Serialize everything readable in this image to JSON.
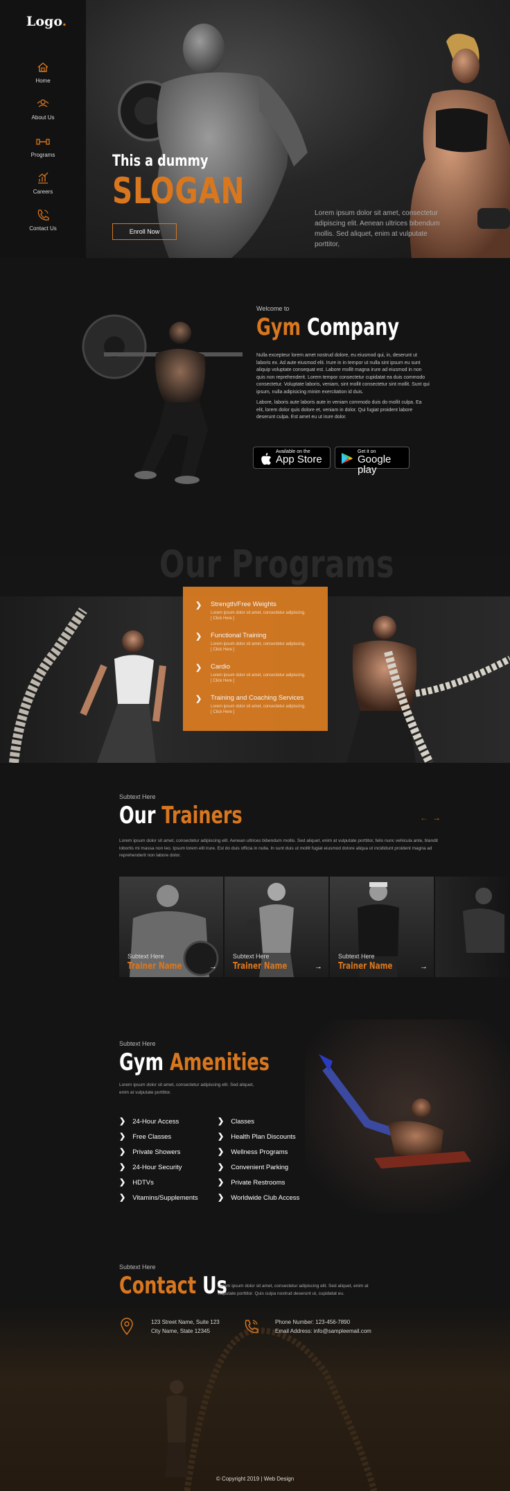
{
  "brand": {
    "logo_text": "Logo",
    "logo_dot": ".",
    "accent": "#d9771f"
  },
  "nav": {
    "items": [
      {
        "label": "Home",
        "icon": "home-icon"
      },
      {
        "label": "About Us",
        "icon": "about-icon"
      },
      {
        "label": "Programs",
        "icon": "dumbbell-icon"
      },
      {
        "label": "Careers",
        "icon": "chart-icon"
      },
      {
        "label": "Contact Us",
        "icon": "phone-icon"
      }
    ]
  },
  "hero": {
    "slogan_small": "This a dummy",
    "slogan_big": "SLOGAN",
    "enroll_label": "Enroll Now",
    "text": "Lorem ipsum dolor sit amet, consectetur adipiscing elit. Aenean ultrices bibendum mollis. Sed aliquet, enim at vulputate porttitor,"
  },
  "company": {
    "welcome": "Welcome to",
    "title_accent": "Gym",
    "title_rest": "Company",
    "para1": "Nulla excepteur lorem amet nostrud dolore, eu eiusmod qui, in, deserunt ut laboris ex. Ad aute eiusmod elit. Irure in in tempor ut nulla sint ipsum eu sunt aliquip voluptate consequat est. Labore mollit magna irure ad eiusmod in non quis non reprehenderit. Lorem tempor consectetur cupidatat ea duis commodo consectetur. Voluptate laboris, veniam, sint mollit consectetur sint mollit. Sunt qui ipsum, nulla adipisicing minim exercitation id duis.",
    "para2": "Labore, laboris aute laboris aute in veniam commodo duis do mollit culpa. Ea elit, lorem dolor quis dolore et, veniam in dolor. Qui fugiat proident labore deserunt culpa. Est amet eu ut irure dolor.",
    "appstore_small": "Available on the",
    "appstore_big": "App Store",
    "googleplay_small": "Get it on",
    "googleplay_big": "Google play"
  },
  "programs": {
    "title": "Our Programs",
    "items": [
      {
        "title": "Strength/Free Weights",
        "desc": "Lorem ipsum dolor sit amet, consectetur adipiscing.",
        "link": "[ Click Here ]"
      },
      {
        "title": "Functional Training",
        "desc": "Lorem ipsum dolor sit amet, consectetur adipiscing.",
        "link": "[ Click Here ]"
      },
      {
        "title": "Cardio",
        "desc": "Lorem ipsum dolor sit amet, consectetur adipiscing.",
        "link": "[ Click Here ]"
      },
      {
        "title": "Training and Coaching Services",
        "desc": "Lorem ipsum dolor sit amet, consectetur adipiscing.",
        "link": "[ Click Here ]"
      }
    ]
  },
  "trainers": {
    "subtext": "Subtext Here",
    "title_white": "Our",
    "title_accent": "Trainers",
    "prev": "←",
    "next": "→",
    "text": "Lorem ipsum dolor sit amet, consectetur adipiscing elit. Aenean ultrices bibendum mollis. Sed aliquet, enim at vulputate porttitor, felis nunc vehicula ante, blandit lobortis mi massa non leo. Ipsum lorem elit irure. Est do duis officia in nulla. In sunt duis ut mollit fugiat eiusmod dolore aliqua ut incididunt proident magna ad reprehenderit non labore dolor.",
    "cards": [
      {
        "sub": "Subtext Here",
        "name": "Trainer Name",
        "arrow": "→"
      },
      {
        "sub": "Subtext Here",
        "name": "Trainer Name",
        "arrow": "→"
      },
      {
        "sub": "Subtext Here",
        "name": "Trainer Name",
        "arrow": "→"
      }
    ]
  },
  "amenities": {
    "subtext": "Subtext Here",
    "title_white": "Gym",
    "title_accent": "Amenities",
    "text": "Lorem ipsum dolor sit amet, consectetur adipiscing elit. Sed aliquet, enim at vulputate porttitor.",
    "left": [
      "24-Hour Access",
      "Free Classes",
      "Private Showers",
      "24-Hour Security",
      "HDTVs",
      "Vitamins/Supplements"
    ],
    "right": [
      "Classes",
      "Health Plan Discounts",
      "Wellness Programs",
      "Convenient Parking",
      "Private Restrooms",
      "Worldwide Club Access"
    ]
  },
  "contact": {
    "subtext": "Subtext Here",
    "title_accent": "Contact",
    "title_white": "Us",
    "text": "Lorem ipsum dolor sit amet, consectetur adipiscing elit. Sed aliquet, enim at vulputate porttitor. Quis culpa nostrud deserunt ut, cupidatat eu.",
    "address_line1": "123 Street Name, Suite 123",
    "address_line2": "City Name, State 12345",
    "phone": "Phone Number: 123-456-7890",
    "email": "Email Address: info@sampleemail.com"
  },
  "footer": {
    "text": "© Copyright 2019  |  Web Design"
  }
}
